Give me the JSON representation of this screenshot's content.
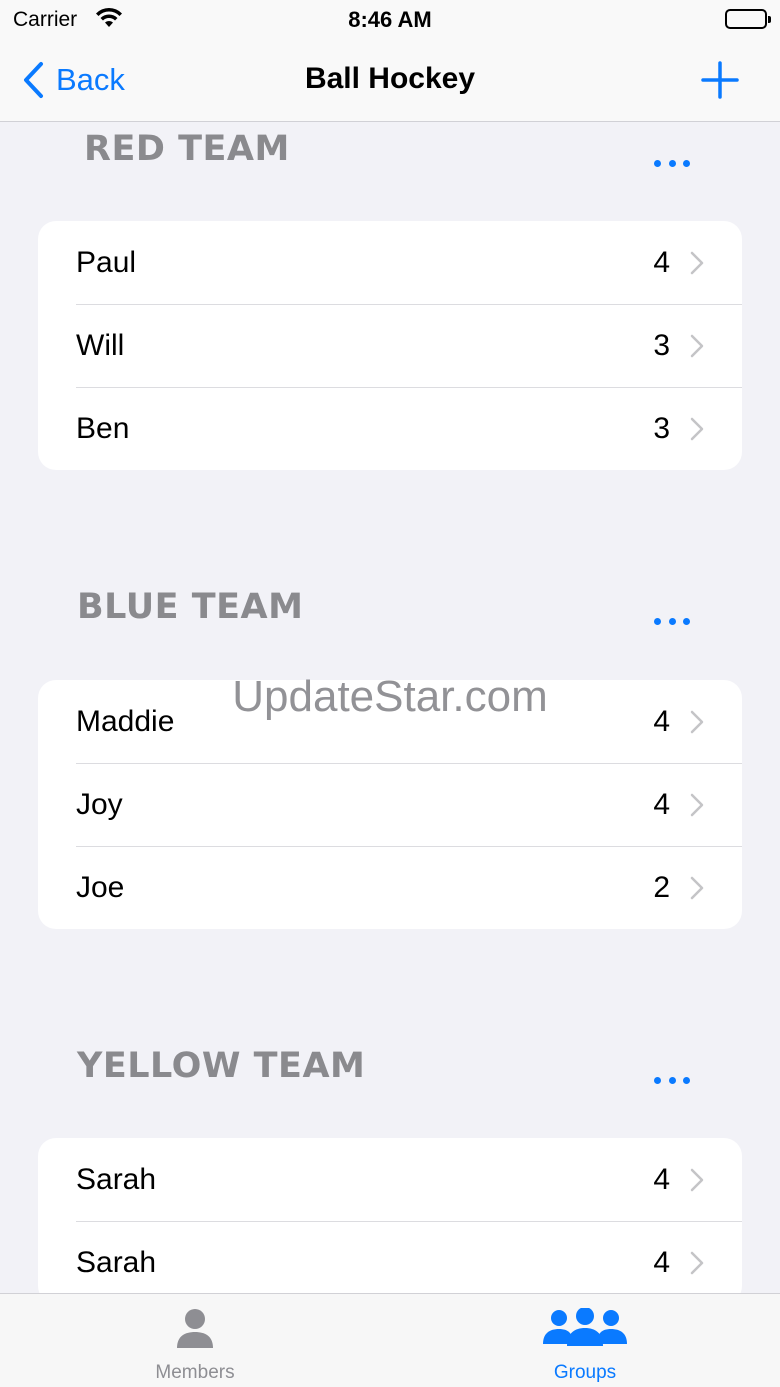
{
  "status_bar": {
    "carrier": "Carrier",
    "time": "8:46 AM"
  },
  "nav": {
    "back_label": "Back",
    "title": "Ball Hockey"
  },
  "sections": [
    {
      "title": "RED TEAM",
      "rows": [
        {
          "name": "Paul",
          "count": "4"
        },
        {
          "name": "Will",
          "count": "3"
        },
        {
          "name": "Ben",
          "count": "3"
        }
      ]
    },
    {
      "title": "BLUE TEAM",
      "rows": [
        {
          "name": "Maddie",
          "count": "4"
        },
        {
          "name": "Joy",
          "count": "4"
        },
        {
          "name": "Joe",
          "count": "2"
        }
      ]
    },
    {
      "title": "YELLOW TEAM",
      "rows": [
        {
          "name": "Sarah",
          "count": "4"
        },
        {
          "name": "Sarah",
          "count": "4"
        }
      ]
    }
  ],
  "watermark": "UpdateStar.com",
  "tabs": [
    {
      "label": "Members",
      "icon": "person-icon",
      "selected": false
    },
    {
      "label": "Groups",
      "icon": "group-icon",
      "selected": true
    }
  ],
  "colors": {
    "accent": "#0a7aff",
    "header_gray": "#8a8a8e",
    "background": "#f2f2f7",
    "inactive_tab": "#8e8e93"
  }
}
